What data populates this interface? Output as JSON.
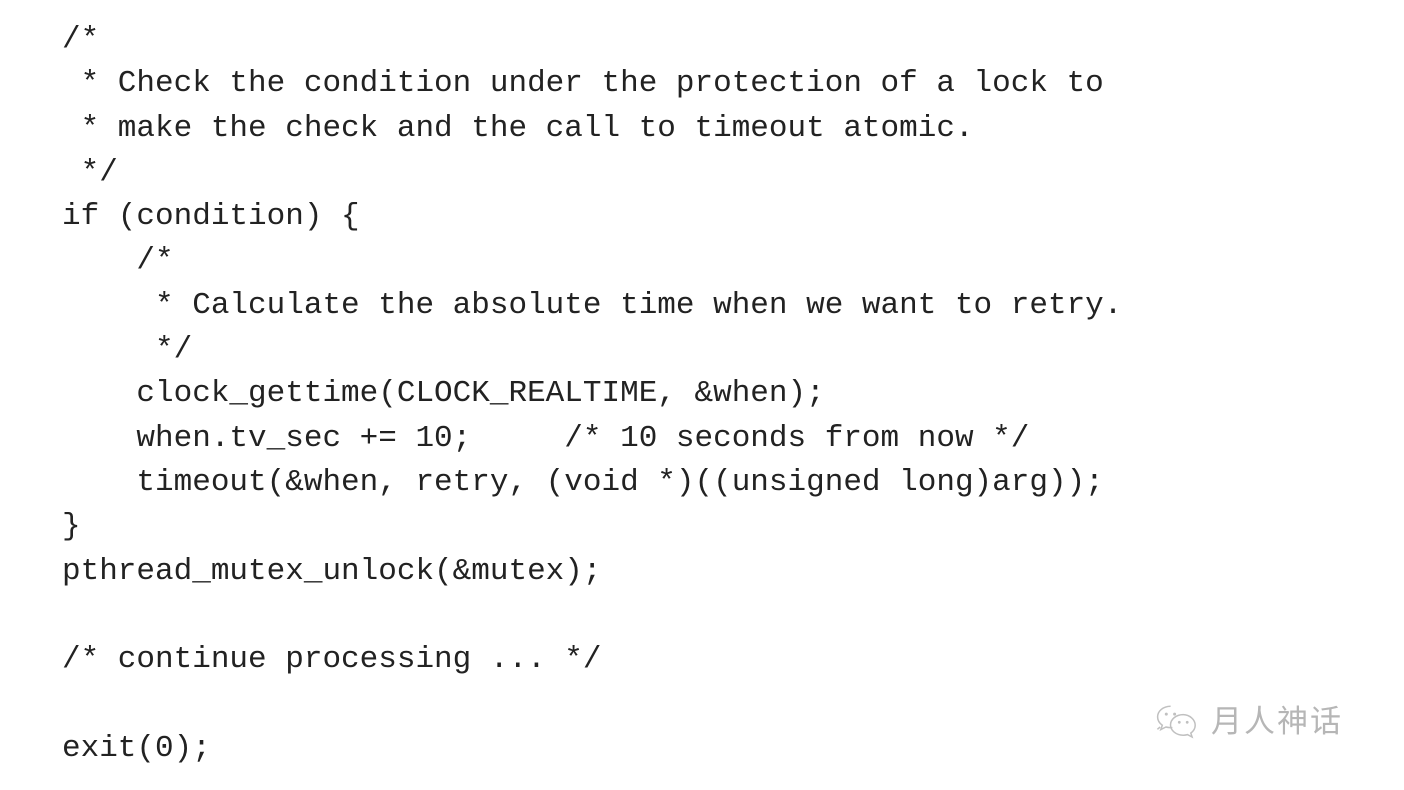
{
  "document": {
    "background_color": "#ffffff",
    "text_color": "#222222",
    "language": "c",
    "code_lines": [
      "/*",
      " * Check the condition under the protection of a lock to",
      " * make the check and the call to timeout atomic.",
      " */",
      "if (condition) {",
      "    /*",
      "     * Calculate the absolute time when we want to retry.",
      "     */",
      "    clock_gettime(CLOCK_REALTIME, &when);",
      "    when.tv_sec += 10;     /* 10 seconds from now */",
      "    timeout(&when, retry, (void *)((unsigned long)arg));",
      "}",
      "pthread_mutex_unlock(&mutex);",
      "",
      "/* continue processing ... */",
      "",
      "exit(0);"
    ]
  },
  "watermark": {
    "icon": "wechat-logo-icon",
    "text": "月人神话",
    "color": "#9a9a9a"
  }
}
